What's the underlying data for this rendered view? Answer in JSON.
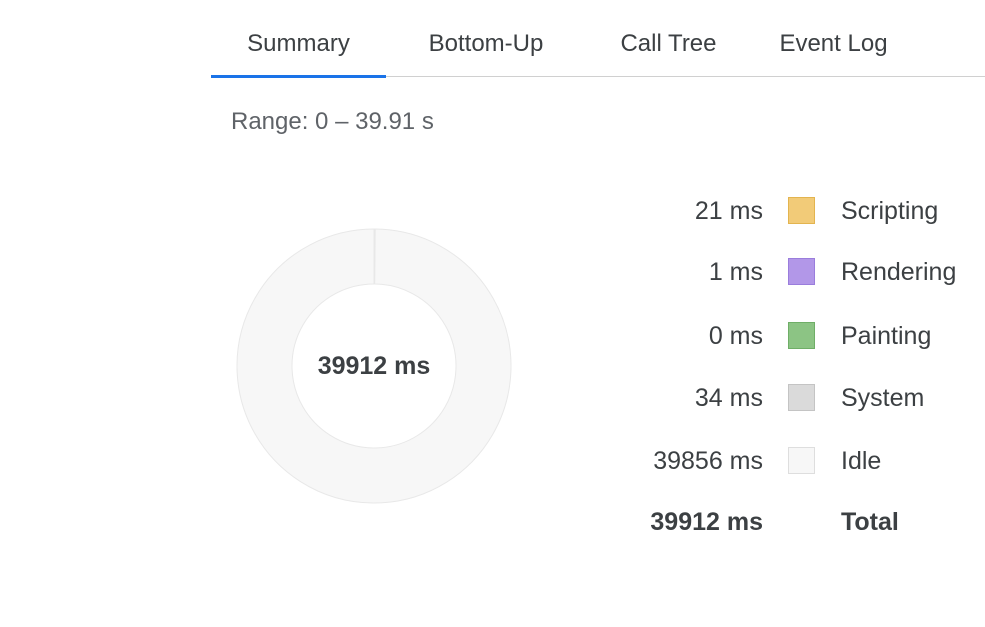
{
  "tabs": [
    {
      "label": "Summary",
      "active": true
    },
    {
      "label": "Bottom-Up",
      "active": false
    },
    {
      "label": "Call Tree",
      "active": false
    },
    {
      "label": "Event Log",
      "active": false
    }
  ],
  "range_text": "Range: 0 – 39.91 s",
  "donut_center": "39912 ms",
  "legend": [
    {
      "value": "21 ms",
      "name": "Scripting",
      "color": "#f2cb78",
      "border": "#e3b44f"
    },
    {
      "value": "1 ms",
      "name": "Rendering",
      "color": "#b297e8",
      "border": "#9a7ddc"
    },
    {
      "value": "0 ms",
      "name": "Painting",
      "color": "#8cc484",
      "border": "#6fae67"
    },
    {
      "value": "34 ms",
      "name": "System",
      "color": "#dadada",
      "border": "#c4c4c4"
    },
    {
      "value": "39856 ms",
      "name": "Idle",
      "color": "#f7f7f7",
      "border": "#dedede"
    }
  ],
  "total": {
    "value": "39912 ms",
    "name": "Total"
  },
  "chart_data": {
    "type": "pie",
    "categories": [
      "Scripting",
      "Rendering",
      "Painting",
      "System",
      "Idle"
    ],
    "values": [
      21,
      1,
      0,
      34,
      39856
    ],
    "unit": "ms"
  }
}
